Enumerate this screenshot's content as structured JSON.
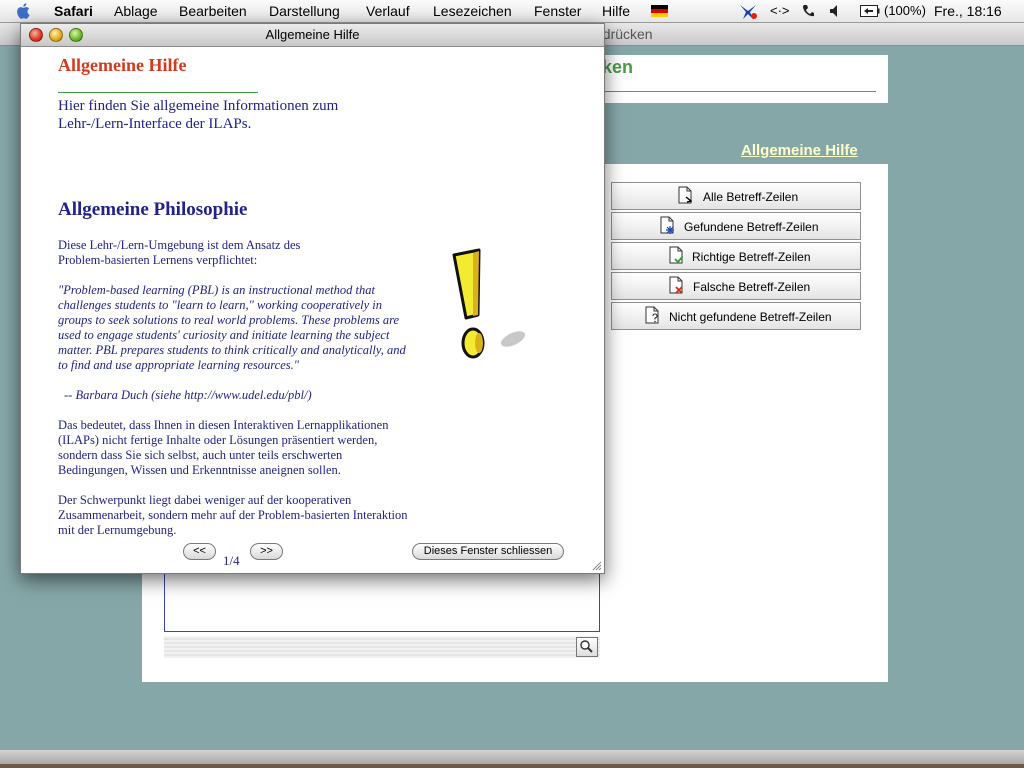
{
  "menubar": {
    "app": "Safari",
    "items": [
      "Ablage",
      "Bearbeiten",
      "Darstellung",
      "Verlauf",
      "Lesezeichen",
      "Fenster",
      "Hilfe"
    ],
    "battery": "(100%)",
    "clock": "Fre., 18:16"
  },
  "background": {
    "window_title": "usdrücken",
    "panel_heading": "cken",
    "help_link": "Allgemeine Hilfe",
    "buttons": [
      {
        "label": "Alle Betreff-Zeilen",
        "icon": "document-arrow-icon"
      },
      {
        "label": "Gefundene Betreff-Zeilen",
        "icon": "document-star-icon"
      },
      {
        "label": "Richtige Betreff-Zeilen",
        "icon": "document-check-icon"
      },
      {
        "label": "Falsche Betreff-Zeilen",
        "icon": "document-cross-icon"
      },
      {
        "label": "Nicht gefundene Betreff-Zeilen",
        "icon": "document-question-icon"
      }
    ]
  },
  "popup": {
    "title": "Allgemeine Hilfe",
    "heading": "Allgemeine Hilfe",
    "intro": "Hier finden Sie allgemeine Informationen zum Lehr-/Lern-Interface der ILAPs.",
    "section_heading": "Allgemeine Philosophie",
    "para1": "Diese Lehr-/Lern-Umgebung ist dem Ansatz des Problem-basierten Lernens verpflichtet:",
    "quote": "\"Problem-based learning (PBL) is an instructional method that challenges students to \"learn to learn,\" working cooperatively in groups to seek solutions to real world problems. These problems are used to engage students' curiosity and initiate learning the subject matter. PBL prepares students to think critically and analytically, and to find and use appropriate learning resources.\"",
    "quote_source": "-- Barbara Duch (siehe http://www.udel.edu/pbl/)",
    "para2": "Das bedeutet, dass Ihnen in diesen Interaktiven Lernapplikationen (ILAPs) nicht fertige Inhalte oder Lösungen präsentiert werden, sondern dass Sie sich selbst, auch unter teils erschwerten Bedingungen, Wissen und Erkenntnisse aneignen sollen.",
    "para3": "Der Schwerpunkt liegt dabei weniger auf der kooperativen Zusammenarbeit, sondern mehr auf der Problem-basierten Interaktion mit der Lernumgebung.",
    "prev_label": "<<",
    "next_label": ">>",
    "page_indicator": "1/4",
    "close_label": "Dieses Fenster schliessen"
  }
}
